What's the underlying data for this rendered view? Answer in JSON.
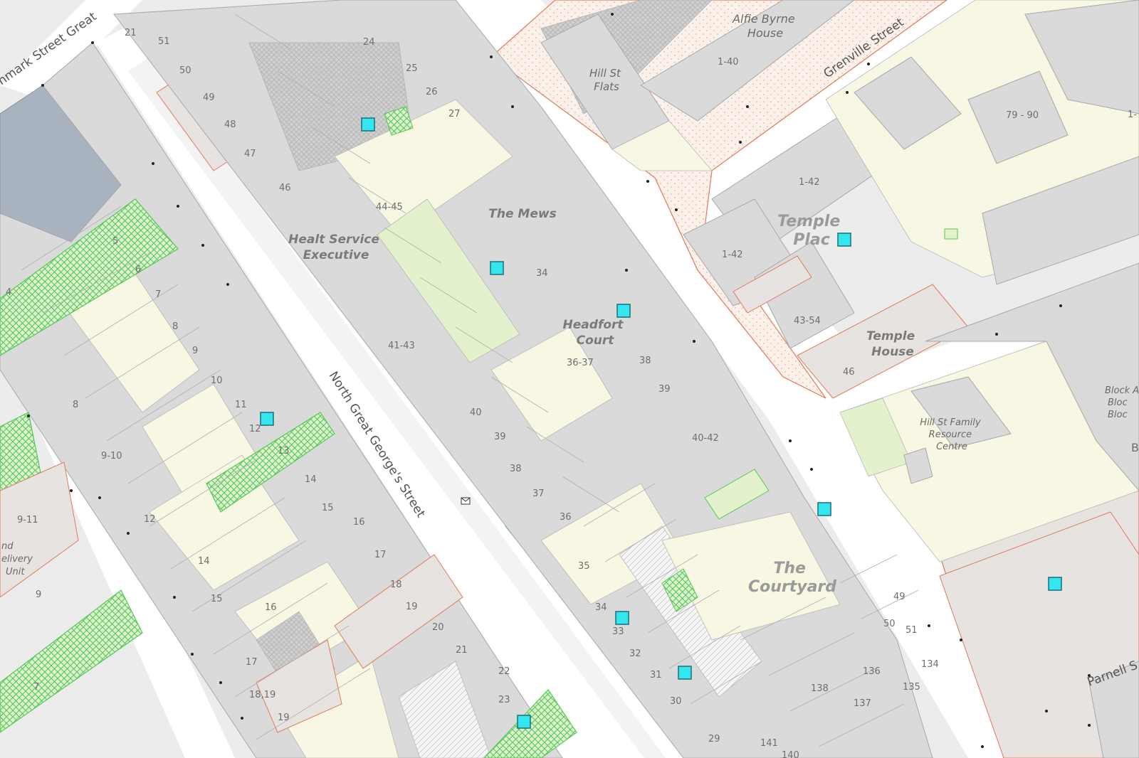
{
  "map": {
    "colors": {
      "background": "#ececec",
      "road": "#ffffff",
      "building": "#dadada",
      "building_outline": "#a8a8a8",
      "yard": "#f7f7e3",
      "green_area": "#e3f2cc",
      "hatch_green": "#55c855",
      "protected_outline": "#e07a5a",
      "marker": "#33e6f0",
      "dark_block": "#a9b2bf"
    },
    "streets": [
      {
        "id": "north-great-georges-street",
        "name": "North Great George's Street"
      },
      {
        "id": "grenville-street",
        "name": "Grenville Street"
      },
      {
        "id": "denmark-street-great",
        "name": "nmark Street Great"
      },
      {
        "id": "parnell-street",
        "name": "Parnell S"
      }
    ],
    "place_labels": [
      {
        "id": "alfie-byrne-house",
        "lines": [
          "Alfie Byrne",
          "House"
        ]
      },
      {
        "id": "hill-st-flats",
        "lines": [
          "Hill St",
          "Flats"
        ]
      },
      {
        "id": "the-mews",
        "lines": [
          "The Mews"
        ]
      },
      {
        "id": "health-service-executive",
        "lines": [
          "Healt Service",
          "Executive"
        ]
      },
      {
        "id": "headfort-court",
        "lines": [
          "Headfort",
          "Court"
        ]
      },
      {
        "id": "temple-place",
        "lines": [
          "Temple",
          "Plac"
        ]
      },
      {
        "id": "temple-house",
        "lines": [
          "Temple",
          "House"
        ]
      },
      {
        "id": "the-courtyard",
        "lines": [
          "The",
          "Courtyard"
        ]
      },
      {
        "id": "hill-st-family-resource-centre",
        "lines": [
          "Hill St Family",
          "Resource",
          "Centre"
        ]
      },
      {
        "id": "block-labels",
        "lines": [
          "Block A",
          "Bloc",
          "Bloc"
        ]
      },
      {
        "id": "delivery-unit",
        "lines": [
          "nd",
          "elivery",
          "Unit"
        ]
      }
    ],
    "house_numbers": [
      "21",
      "51",
      "50",
      "49",
      "48",
      "47",
      "46",
      "24",
      "25",
      "26",
      "27",
      "44-45",
      "1-40",
      "79 - 90",
      "1-42",
      "1-42",
      "34",
      "38",
      "39",
      "36-37",
      "40",
      "39",
      "38",
      "37",
      "36",
      "35",
      "34",
      "33",
      "32",
      "31",
      "30",
      "29",
      "41-43",
      "40-42",
      "43-54",
      "46",
      "5",
      "6",
      "4",
      "7",
      "8",
      "9",
      "10",
      "11",
      "12",
      "13",
      "14",
      "15",
      "16",
      "17",
      "18",
      "19",
      "20",
      "21",
      "22",
      "23",
      "8",
      "9-10",
      "9-11",
      "12",
      "14",
      "15",
      "16",
      "17",
      "18,19",
      "19",
      "9",
      "141",
      "140",
      "138",
      "137",
      "136",
      "135",
      "134",
      "49",
      "50",
      "51",
      "1-",
      "B",
      "7"
    ],
    "markers": [
      "marker-1",
      "marker-2",
      "marker-3",
      "marker-4",
      "marker-5",
      "marker-6",
      "marker-7",
      "marker-8",
      "marker-9",
      "marker-10",
      "marker-11"
    ],
    "letterbox_icon": "envelope-icon"
  }
}
